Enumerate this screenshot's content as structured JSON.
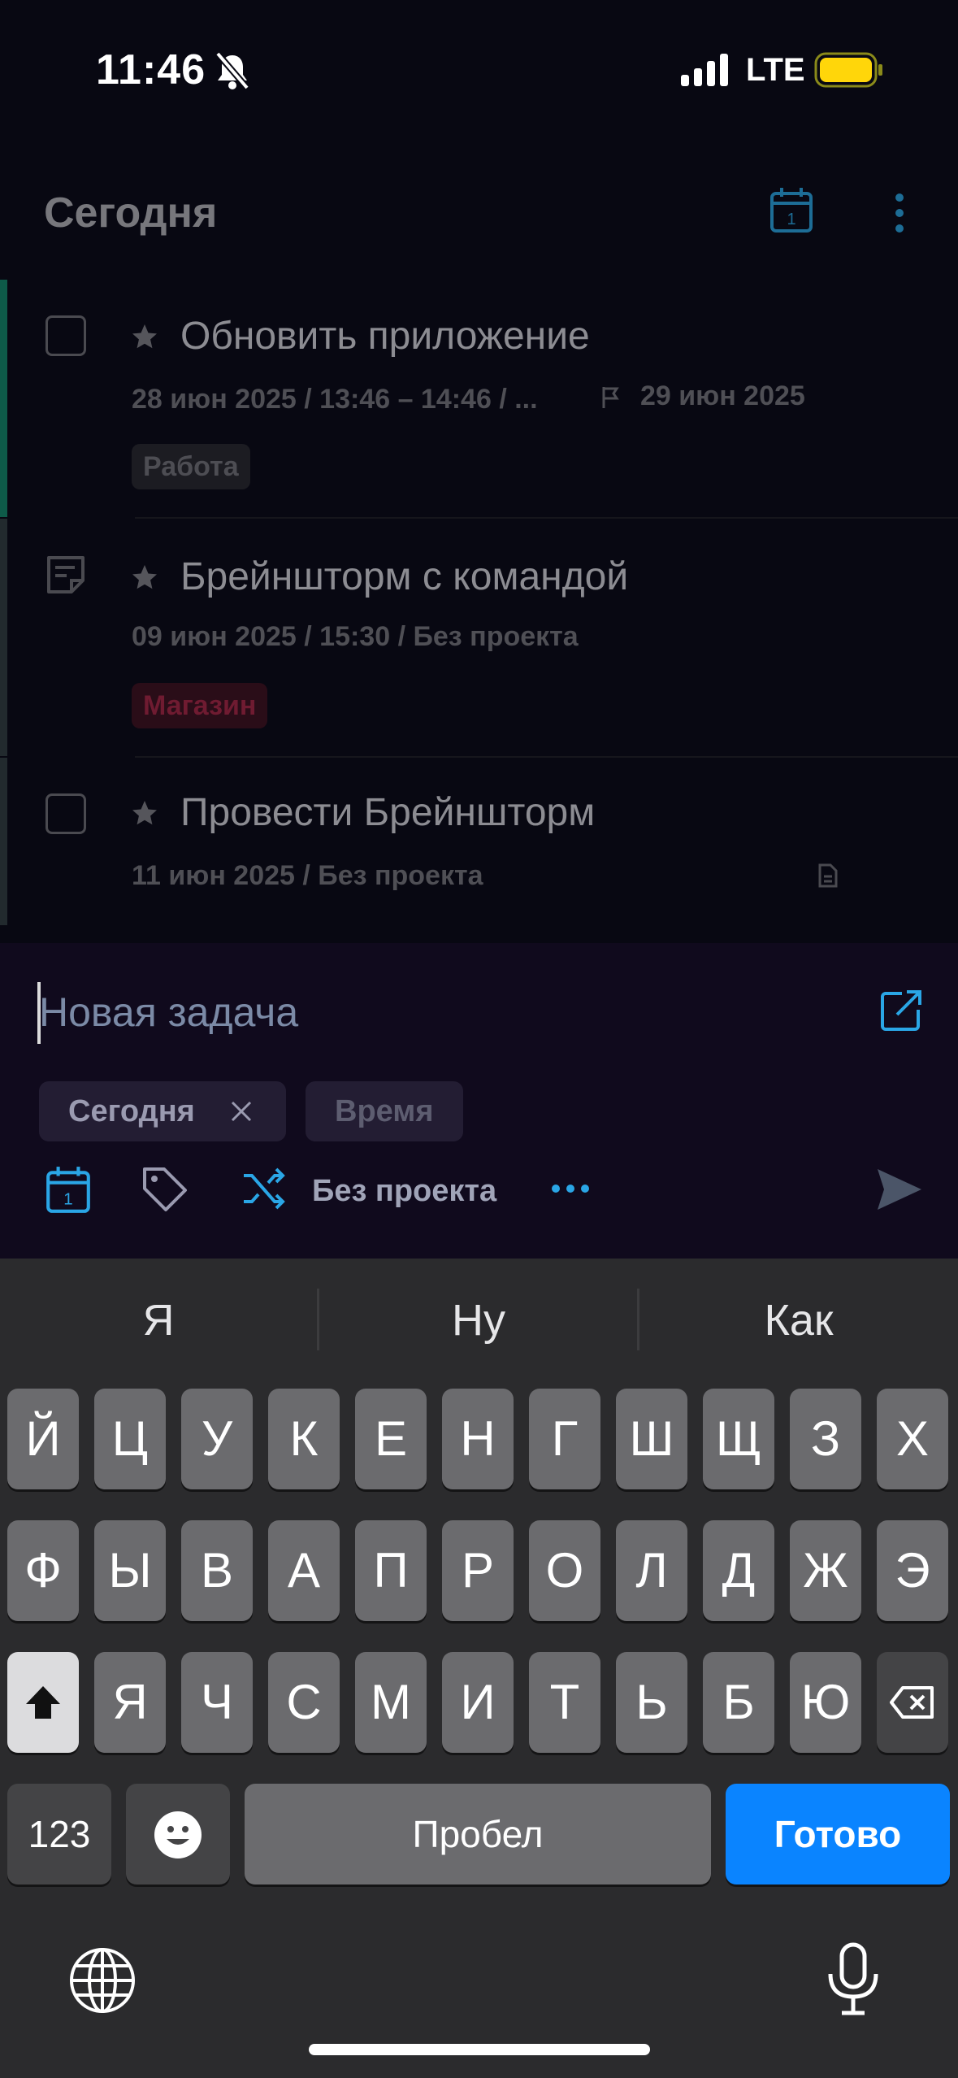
{
  "status_bar": {
    "time": "11:46",
    "network": "LTE"
  },
  "header": {
    "title": "Сегодня"
  },
  "tasks": [
    {
      "title": "Обновить приложение",
      "meta": "28 июн 2025 / 13:46 – 14:46 / ...",
      "deadline": "29 июн 2025",
      "tag": "Работа",
      "accent": "#0e6b55",
      "tag_color": "#3a3a40"
    },
    {
      "title": "Брейншторм с командой",
      "meta": "09 июн 2025 / 15:30 / Без проекта",
      "tag": "Магазин",
      "accent": "#2d3a40",
      "tag_color": "#6a1a2c"
    },
    {
      "title": "Провести Брейншторм",
      "meta": "11 июн 2025 / Без проекта",
      "accent": "#2d3a40"
    }
  ],
  "composer": {
    "placeholder": "Новая задача",
    "chips": {
      "today": "Сегодня",
      "time": "Время"
    },
    "project": "Без проекта"
  },
  "keyboard": {
    "suggestions": [
      "Я",
      "Ну",
      "Как"
    ],
    "row1": [
      "Й",
      "Ц",
      "У",
      "К",
      "Е",
      "Н",
      "Г",
      "Ш",
      "Щ",
      "З",
      "Х"
    ],
    "row2": [
      "Ф",
      "Ы",
      "В",
      "А",
      "П",
      "Р",
      "О",
      "Л",
      "Д",
      "Ж",
      "Э"
    ],
    "row3": [
      "Я",
      "Ч",
      "С",
      "М",
      "И",
      "Т",
      "Ь",
      "Б",
      "Ю"
    ],
    "numbers_label": "123",
    "space_label": "Пробел",
    "done_label": "Готово"
  },
  "colors": {
    "accent_blue": "#2aa6e6",
    "done_blue": "#0a84ff"
  }
}
